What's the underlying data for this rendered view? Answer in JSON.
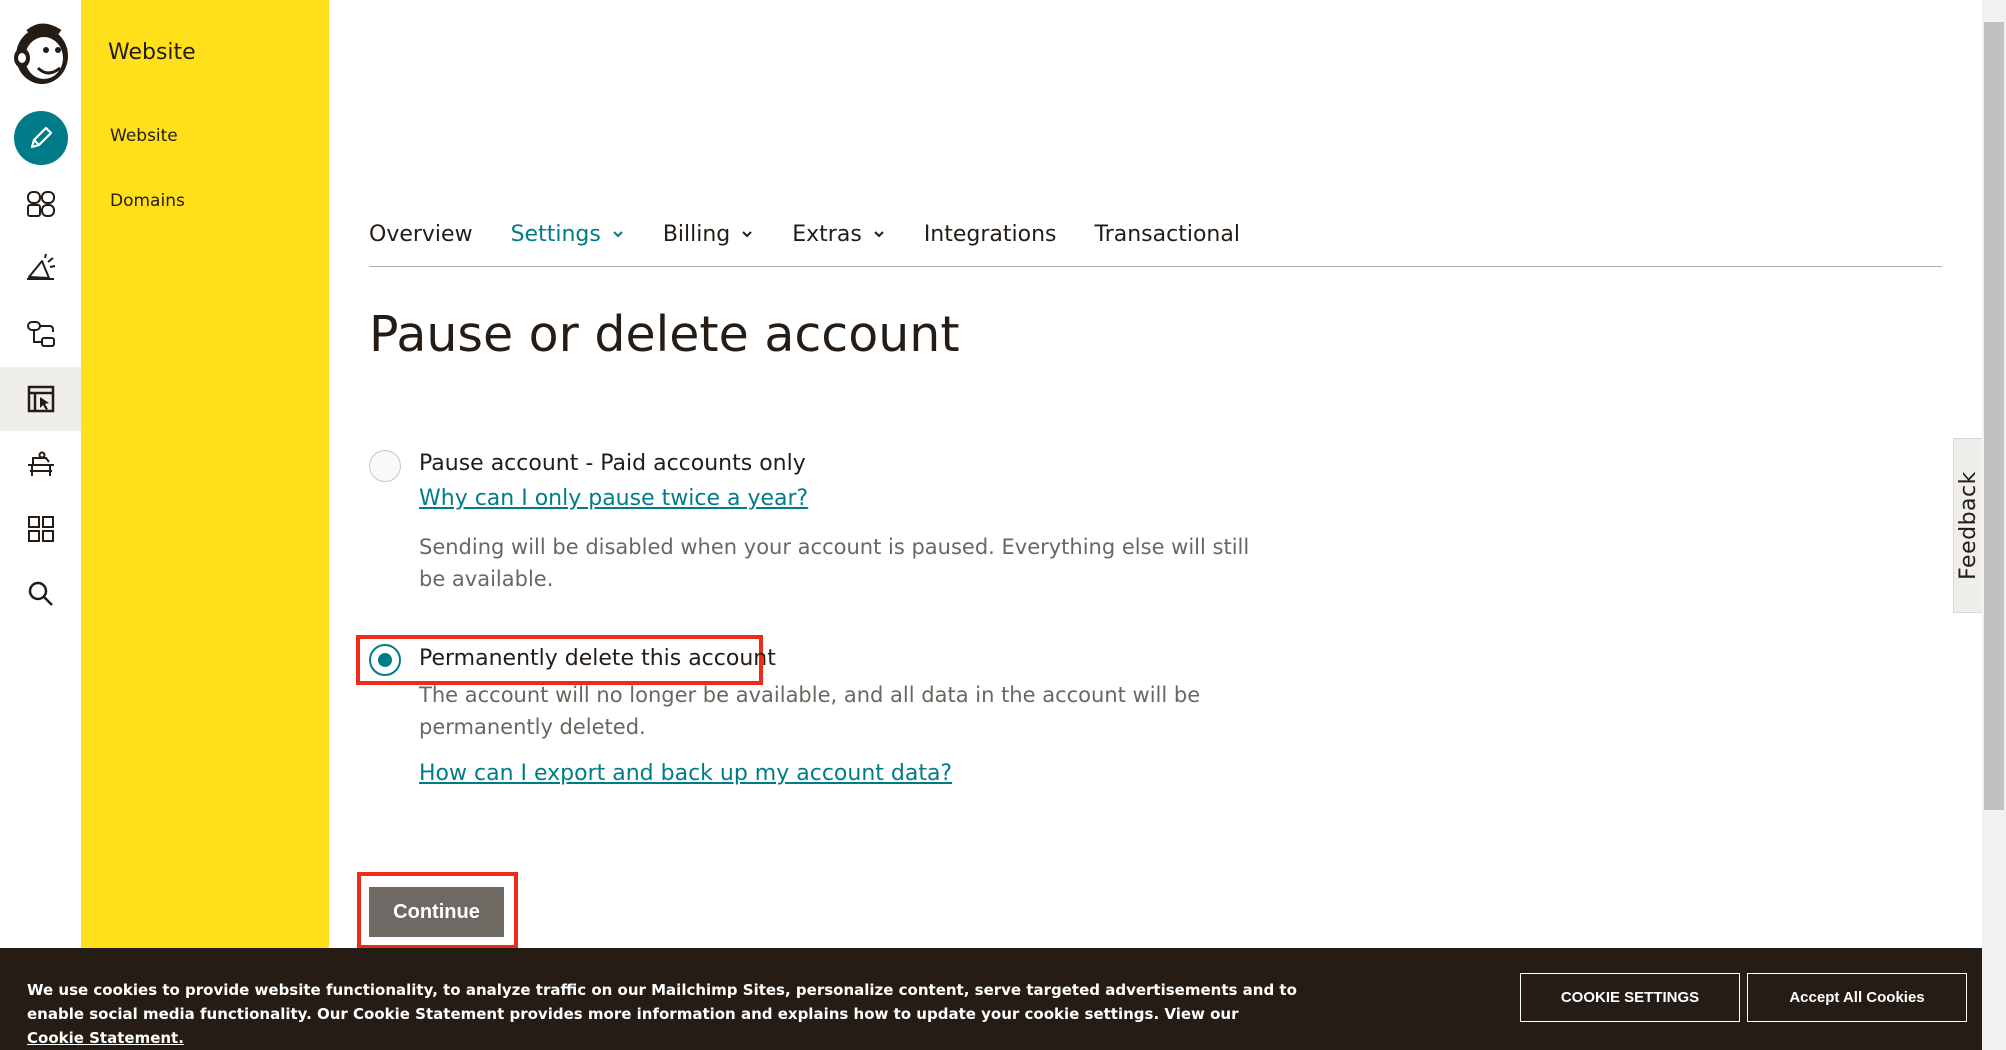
{
  "sidebar": {
    "section_title": "Website",
    "items": [
      "Website",
      "Domains"
    ]
  },
  "rail_icons": [
    "mailchimp-logo",
    "pencil-icon",
    "audience-icon",
    "campaign-icon",
    "automation-icon",
    "website-icon",
    "integrations-icon",
    "apps-grid-icon",
    "search-icon"
  ],
  "tabs": [
    {
      "label": "Overview",
      "active": false,
      "dropdown": false
    },
    {
      "label": "Settings",
      "active": true,
      "dropdown": true
    },
    {
      "label": "Billing",
      "active": false,
      "dropdown": true
    },
    {
      "label": "Extras",
      "active": false,
      "dropdown": true
    },
    {
      "label": "Integrations",
      "active": false,
      "dropdown": false
    },
    {
      "label": "Transactional",
      "active": false,
      "dropdown": false
    }
  ],
  "page": {
    "title": "Pause or delete account",
    "pause": {
      "label": "Pause account - Paid accounts only",
      "link": "Why can I only pause twice a year?",
      "description": "Sending will be disabled when your account is paused. Everything else will still be available.",
      "checked": false
    },
    "delete": {
      "label": "Permanently delete this account",
      "description": "The account will no longer be available, and all data in the account will be permanently deleted.",
      "link": "How can I export and back up my account data?",
      "checked": true
    },
    "continue_label": "Continue"
  },
  "feedback_label": "Feedback",
  "cookie_banner": {
    "text": "We use cookies to provide website functionality, to analyze traffic on our Mailchimp Sites, personalize content, serve targeted advertisements and to enable social media functionality. Our Cookie Statement provides more information and explains how to update your cookie settings. View our",
    "link": "Cookie Statement.",
    "settings_label": "COOKIE SETTINGS",
    "accept_label": "Accept All Cookies"
  },
  "colors": {
    "accent": "#007c89",
    "sidebar_yellow": "#ffe01b",
    "highlight_red": "#ee2b18",
    "banner_dark": "#241c15"
  }
}
